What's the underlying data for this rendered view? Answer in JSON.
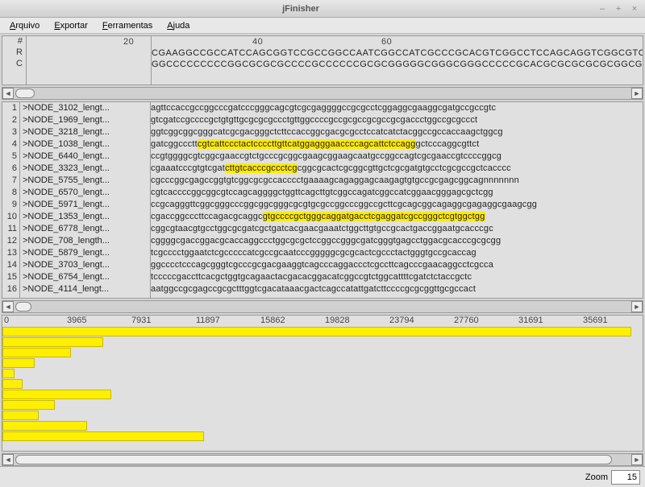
{
  "window": {
    "title": "jFinisher",
    "min": "–",
    "max": "+",
    "close": "×"
  },
  "menu": {
    "arquivo": "Arquivo",
    "exportar": "Exportar",
    "ferramentas": "Ferramentas",
    "ajuda": "Ajuda"
  },
  "ref": {
    "cols": {
      "hash": "#",
      "r": "R",
      "c": "C"
    },
    "ticks": {
      "t20": "20",
      "t40": "40",
      "t60": "60"
    },
    "seqR": "CGAAGGCCGCCATCCAGCGGTCCGCCGGCCAATCGGCCATCGCCCGCACGTCGGCCTCCAGCAGGTCGGCGTCTGG",
    "seqC": "GGCCCCCCCCCGGCGCGCGCCCCGCCCCCCGCGCGGGGGCGGGCGGGCCCCCGCACGCGCGCGCGCGGCGG"
  },
  "rows": [
    {
      "n": "1",
      "name": ">NODE_3102_lengt...",
      "seq": "agttccaccgccggcccgatcccgggcagcgtcgcgaggggccgcgcctcggaggcgaaggcgatgccgccgtc"
    },
    {
      "n": "2",
      "name": ">NODE_1969_lengt...",
      "seq": "gtcgatccgccccgctgtgttgcgcgcgccctgttggccccgccgcgccgcgccgcgaccctggccgcgccct"
    },
    {
      "n": "3",
      "name": ">NODE_3218_lengt...",
      "seq": "ggtcggcggcgggcatcgcgacgggctcttccaccggcgacgcgcctccatcatctacggccgccaccaagctggcg"
    },
    {
      "n": "4",
      "name": ">NODE_1038_lengt...",
      "seq": "gatcggccctt",
      "hl": "cgtcattccctactccccttgttcatggagggaaccccagcattctccagg",
      "seq2": "gctcccaggcgttct"
    },
    {
      "n": "5",
      "name": ">NODE_6440_lengt...",
      "seq": "ccgtggggcgtcggcgaaccgtctgcccgcggcgaagcggaagcaatgccggccagtcgcgaaccgtccccggcg"
    },
    {
      "n": "6",
      "name": ">NODE_3323_lengt...",
      "seq": "cgaaatcccgtgtcgat",
      "hl": "cttgtcacccgccctcg",
      "seq2": "cggcgcactcgcggcgttgctcgcgatgtgcctcgcgccgctcacccc"
    },
    {
      "n": "7",
      "name": ">NODE_5755_lengt...",
      "seq": "cgcccggcgagccggtgtcggcgcgccacccctgaaaagcagaggagcaagagtgtgccgcgagcggcagnnnnnnn"
    },
    {
      "n": "8",
      "name": ">NODE_6570_lengt...",
      "seq": "cgtcaccccggcggcgtccagcaggggctggttcagcttgtcggccagatcggccatcggaacgggagcgctcgg"
    },
    {
      "n": "9",
      "name": ">NODE_5971_lengt...",
      "seq": "ccgcagggttcggcgggcccggcggcgggcgcgtgcgccggcccggccgcttcgcagcggcagaggcgagaggcgaagcgg"
    },
    {
      "n": "10",
      "name": ">NODE_1353_lengt...",
      "seq": "cgaccggcccttccagacgcaggc",
      "hl": "gtgccccgctgggcaggatgacctcgaggatcgccgggctcgtggctgg"
    },
    {
      "n": "11",
      "name": ">NODE_6778_lengt...",
      "seq": "cggcgtaacgtgcctggcgcgatcgctgatcacgaacgaaatctggcttgtgccgcactgaccggaatgcacccgc"
    },
    {
      "n": "12",
      "name": ">NODE_708_length...",
      "seq": "cggggcgaccggacgcaccaggccctggcgcgctccggccgggcgatcgggtgagcctggacgcacccgcgcgg"
    },
    {
      "n": "13",
      "name": ">NODE_5879_lengt...",
      "seq": "tcgcccctggaatctcgcccccatcgccgcaatcccgggggcgcgcactcgccctactgggtgccgcaccag"
    },
    {
      "n": "14",
      "name": ">NODE_3703_lengt...",
      "seq": "ggcccctcccagcgggtcgcccgcgacgaaggtcagcccaggaccctcgccttcagcccgaacaggcctcgcca"
    },
    {
      "n": "15",
      "name": ">NODE_6754_lengt...",
      "seq": "tcccccgaccttcacgctggtgcagaactacgacacggacatcggccgtctggcattttcgatctctaccgctc"
    },
    {
      "n": "16",
      "name": ">NODE_4114_lengt...",
      "seq": "aatggccgcgagccgcgctttggtcgacataaacgactcagccatattgatcttccccgcgcggttgcgccact"
    }
  ],
  "coverage": {
    "ticks": {
      "t0": "0",
      "t1": "3965",
      "t2": "7931",
      "t3": "11897",
      "t4": "15862",
      "t5": "19828",
      "t6": "23794",
      "t7": "27760",
      "t8": "31691",
      "t9": "35691"
    },
    "bars": [
      780,
      125,
      85,
      40,
      15,
      25,
      135,
      65,
      45,
      105,
      250
    ]
  },
  "status": {
    "zoom_label": "Zoom",
    "zoom_value": "15"
  }
}
